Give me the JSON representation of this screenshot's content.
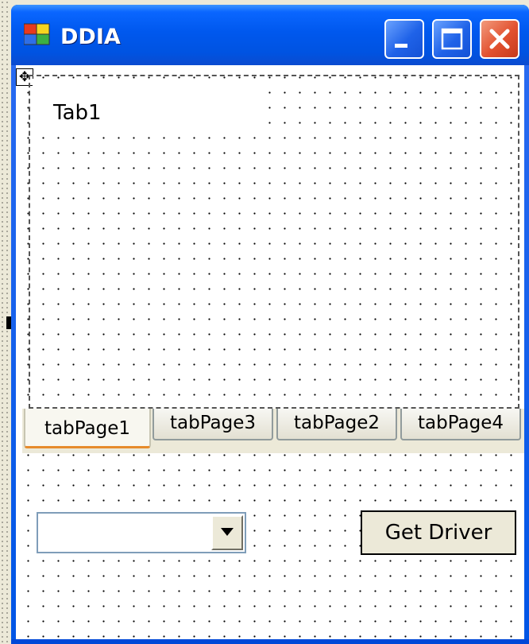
{
  "window": {
    "title": "DDIA",
    "icon": "windows-form-icon",
    "controls": {
      "minimize_icon": "minimize-icon",
      "maximize_icon": "maximize-icon",
      "close_icon": "close-icon"
    }
  },
  "designer": {
    "move_glyph": "✥",
    "move_icon": "move-icon"
  },
  "tab_control": {
    "selected_page_label": "Tab1",
    "tabs": [
      {
        "label": "tabPage1",
        "selected": true
      },
      {
        "label": "tabPage3",
        "selected": false
      },
      {
        "label": "tabPage2",
        "selected": false
      },
      {
        "label": "tabPage4",
        "selected": false
      }
    ]
  },
  "combo": {
    "value": "",
    "dropdown_icon": "chevron-down-icon"
  },
  "driver_button": {
    "label": "Get Driver"
  },
  "colors": {
    "title_bar": "#0058ee",
    "close_button": "#e2512f",
    "form_background": "#ffffff",
    "control_face": "#ece9d8",
    "selected_tab_accent": "#e68b2c"
  }
}
